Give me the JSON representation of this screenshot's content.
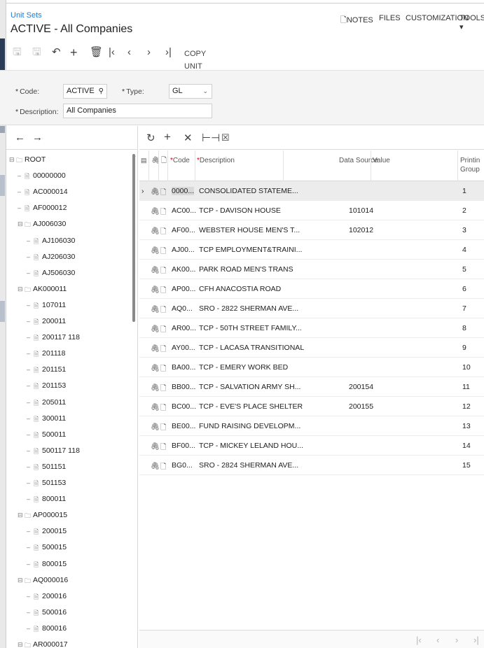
{
  "header": {
    "breadcrumb": "Unit Sets",
    "title": "ACTIVE - All Companies",
    "menu": [
      "NOTES",
      "FILES",
      "CUSTOMIZATION",
      "TOOLS ▾"
    ]
  },
  "toolbar": {
    "icons": [
      "save-icon",
      "save-close-icon",
      "undo-icon",
      "add-icon",
      "delete-icon",
      "first-icon",
      "prev-icon",
      "next-icon",
      "last-icon"
    ],
    "copy_label": "COPY UNIT SET"
  },
  "form": {
    "code_label": "Code:",
    "code_value": "ACTIVE",
    "type_label": "Type:",
    "type_value": "GL",
    "description_label": "Description:",
    "description_value": "All Companies"
  },
  "tree": {
    "nodes": [
      {
        "label": "ROOT",
        "kind": "folder",
        "level": 0
      },
      {
        "label": "00000000",
        "kind": "leaf",
        "level": 1
      },
      {
        "label": "AC000014",
        "kind": "leaf",
        "level": 1
      },
      {
        "label": "AF000012",
        "kind": "leaf",
        "level": 1
      },
      {
        "label": "AJ006030",
        "kind": "folder",
        "level": 1
      },
      {
        "label": "AJ106030",
        "kind": "leaf",
        "level": 2
      },
      {
        "label": "AJ206030",
        "kind": "leaf",
        "level": 2
      },
      {
        "label": "AJ506030",
        "kind": "leaf",
        "level": 2
      },
      {
        "label": "AK000011",
        "kind": "folder",
        "level": 1
      },
      {
        "label": "107011",
        "kind": "leaf",
        "level": 2
      },
      {
        "label": "200011",
        "kind": "leaf",
        "level": 2
      },
      {
        "label": "200117 118",
        "kind": "leaf",
        "level": 2
      },
      {
        "label": "201118",
        "kind": "leaf",
        "level": 2
      },
      {
        "label": "201151",
        "kind": "leaf",
        "level": 2
      },
      {
        "label": "201153",
        "kind": "leaf",
        "level": 2
      },
      {
        "label": "205011",
        "kind": "leaf",
        "level": 2
      },
      {
        "label": "300011",
        "kind": "leaf",
        "level": 2
      },
      {
        "label": "500011",
        "kind": "leaf",
        "level": 2
      },
      {
        "label": "500117 118",
        "kind": "leaf",
        "level": 2
      },
      {
        "label": "501151",
        "kind": "leaf",
        "level": 2
      },
      {
        "label": "501153",
        "kind": "leaf",
        "level": 2
      },
      {
        "label": "800011",
        "kind": "leaf",
        "level": 2
      },
      {
        "label": "AP000015",
        "kind": "folder",
        "level": 1
      },
      {
        "label": "200015",
        "kind": "leaf",
        "level": 2
      },
      {
        "label": "500015",
        "kind": "leaf",
        "level": 2
      },
      {
        "label": "800015",
        "kind": "leaf",
        "level": 2
      },
      {
        "label": "AQ000016",
        "kind": "folder",
        "level": 1
      },
      {
        "label": "200016",
        "kind": "leaf",
        "level": 2
      },
      {
        "label": "500016",
        "kind": "leaf",
        "level": 2
      },
      {
        "label": "800016",
        "kind": "leaf",
        "level": 2
      },
      {
        "label": "AR000017",
        "kind": "folder",
        "level": 1
      }
    ]
  },
  "grid": {
    "columns": {
      "code": "Code",
      "description": "Description",
      "data_source": "Data Source",
      "value": "Value",
      "printing_group_1": "Printin",
      "printing_group_2": "Group"
    },
    "rows": [
      {
        "code": "0000...",
        "description": "CONSOLIDATED STATEME...",
        "data_source": "",
        "group": "1"
      },
      {
        "code": "AC00...",
        "description": "TCP - DAVISON HOUSE",
        "data_source": "101014",
        "group": "2"
      },
      {
        "code": "AF00...",
        "description": "WEBSTER HOUSE MEN'S T...",
        "data_source": "102012",
        "group": "3"
      },
      {
        "code": "AJ00...",
        "description": "TCP EMPLOYMENT&TRAINI...",
        "data_source": "",
        "group": "4"
      },
      {
        "code": "AK00...",
        "description": "PARK ROAD MEN'S TRANS",
        "data_source": "",
        "group": "5"
      },
      {
        "code": "AP00...",
        "description": "CFH ANACOSTIA ROAD",
        "data_source": "",
        "group": "6"
      },
      {
        "code": "AQ0...",
        "description": "SRO - 2822 SHERMAN AVE...",
        "data_source": "",
        "group": "7"
      },
      {
        "code": "AR00...",
        "description": "TCP - 50TH STREET FAMILY...",
        "data_source": "",
        "group": "8"
      },
      {
        "code": "AY00...",
        "description": "TCP - LACASA TRANSITIONAL",
        "data_source": "",
        "group": "9"
      },
      {
        "code": "BA00...",
        "description": "TCP - EMERY WORK BED",
        "data_source": "",
        "group": "10"
      },
      {
        "code": "BB00...",
        "description": "TCP - SALVATION ARMY SH...",
        "data_source": "200154",
        "group": "11"
      },
      {
        "code": "BC00...",
        "description": "TCP - EVE'S PLACE SHELTER",
        "data_source": "200155",
        "group": "12"
      },
      {
        "code": "BE00...",
        "description": "FUND RAISING DEVELOPM...",
        "data_source": "",
        "group": "13"
      },
      {
        "code": "BF00...",
        "description": "TCP - MICKEY LELAND HOU...",
        "data_source": "",
        "group": "14"
      },
      {
        "code": "BG0...",
        "description": "SRO - 2824 SHERMAN AVE...",
        "data_source": "",
        "group": "15"
      }
    ]
  }
}
